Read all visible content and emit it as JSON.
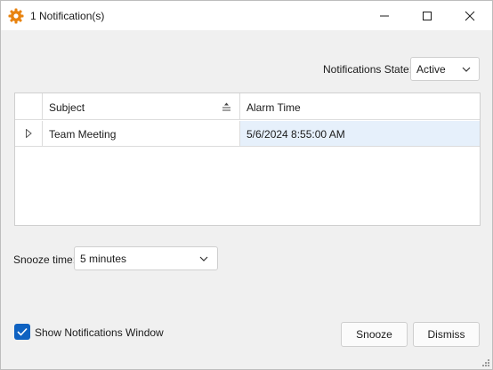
{
  "window": {
    "title": "1 Notification(s)",
    "icon": "gear-icon",
    "controls": {
      "minimize": "minimize-icon",
      "maximize": "maximize-icon",
      "close": "close-icon"
    }
  },
  "filter": {
    "label": "Notifications State:",
    "value": "Active"
  },
  "grid": {
    "columns": [
      "Subject",
      "Alarm Time"
    ],
    "rows": [
      {
        "subject": "Team Meeting",
        "alarm_time": "5/6/2024 8:55:00 AM"
      }
    ]
  },
  "snooze": {
    "label": "Snooze time:",
    "value": "5 minutes"
  },
  "show_window": {
    "label": "Show Notifications Window",
    "checked": true
  },
  "buttons": {
    "snooze": "Snooze",
    "dismiss": "Dismiss"
  },
  "colors": {
    "accent": "#0f62c1",
    "icon_orange": "#e8830f",
    "selected_cell": "#e6f0fb"
  }
}
